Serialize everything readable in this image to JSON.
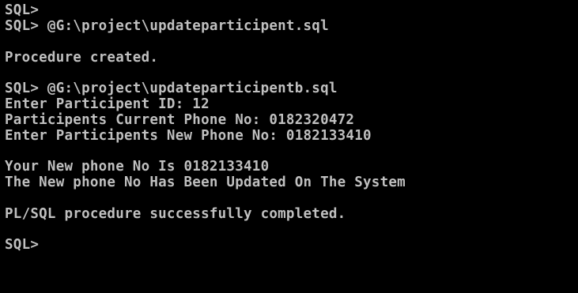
{
  "console": {
    "text_color": "#c0c0c0",
    "background_color": "#000000",
    "lines": [
      "SQL>",
      "SQL> @G:\\project\\updateparticipent.sql",
      "Procedure created.",
      "SQL> @G:\\project\\updateparticipentb.sql",
      "Enter Participent ID: 12",
      "Participents Current Phone No: 0182320472",
      "Enter Participents New Phone No: 0182133410",
      "Your New phone No Is 0182133410",
      "The New phone No Has Been Updated On The System",
      "PL/SQL procedure successfully completed.",
      "SQL>"
    ]
  }
}
